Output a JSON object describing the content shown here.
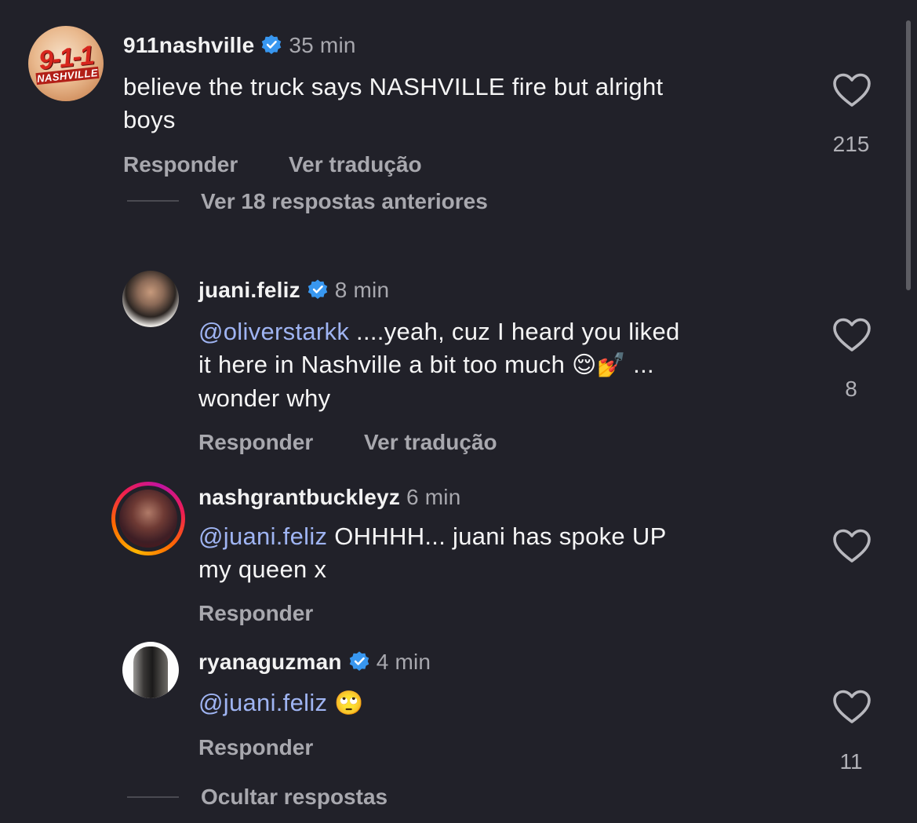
{
  "comments": [
    {
      "username": "911nashville",
      "verified": true,
      "time": "35 min",
      "avatar_text": "9-1-1",
      "avatar_subtext": "NASHVILLE",
      "text_lines": [
        "believe the truck says NASHVILLE fire but alright",
        "boys"
      ],
      "reply_label": "Responder",
      "translate_label": "Ver tradução",
      "likes": "215",
      "view_previous_label": "Ver 18 respostas anteriores"
    },
    {
      "username": "juani.feliz",
      "verified": true,
      "time": "8 min",
      "mention": "@oliverstarkk",
      "text_line1_rest": " ....yeah, cuz I heard you liked",
      "text_line2": "it here in Nashville a bit too much ",
      "emoji1": "😌",
      "emoji2": "💅",
      "text_line2_end": " ...",
      "text_line3": "wonder why",
      "reply_label": "Responder",
      "translate_label": "Ver tradução",
      "likes": "8"
    },
    {
      "username": "nashgrantbuckleyz",
      "verified": false,
      "time": "6 min",
      "mention": "@juani.feliz",
      "text_line1_rest": " OHHHH... juani has spoke UP",
      "text_line2": "my queen x",
      "reply_label": "Responder",
      "likes": ""
    },
    {
      "username": "ryanaguzman",
      "verified": true,
      "time": "4 min",
      "mention": "@juani.feliz",
      "emoji": "🙄",
      "reply_label": "Responder",
      "likes": "11"
    }
  ],
  "hide_replies_label": "Ocultar respostas",
  "colors": {
    "background": "#212129",
    "mention": "#9fb4f2",
    "verified": "#3897f0",
    "secondary_text": "#a8a8ae"
  }
}
